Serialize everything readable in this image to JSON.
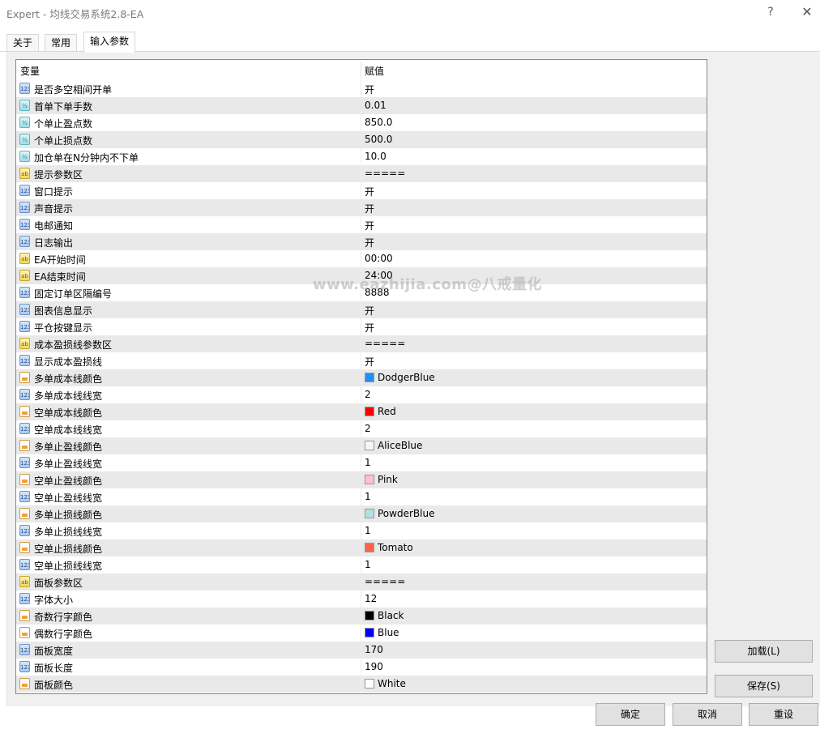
{
  "window": {
    "title": "Expert - 均线交易系统2.8-EA",
    "help": "?",
    "close": "✕"
  },
  "tabs": [
    {
      "label": "关于"
    },
    {
      "label": "常用"
    },
    {
      "label": "输入参数"
    }
  ],
  "grid": {
    "header_variable": "变量",
    "header_value": "赋值",
    "rows": [
      {
        "name": "是否多空相间开单",
        "value": "开",
        "type": "int"
      },
      {
        "name": "首单下单手数",
        "value": "0.01",
        "type": "dbl"
      },
      {
        "name": "个单止盈点数",
        "value": "850.0",
        "type": "dbl"
      },
      {
        "name": "个单止损点数",
        "value": "500.0",
        "type": "dbl"
      },
      {
        "name": "加仓单在N分钟内不下单",
        "value": "10.0",
        "type": "dbl"
      },
      {
        "name": "提示参数区",
        "value": "=====",
        "type": "str"
      },
      {
        "name": "窗口提示",
        "value": "开",
        "type": "int"
      },
      {
        "name": "声音提示",
        "value": "开",
        "type": "int"
      },
      {
        "name": "电邮通知",
        "value": "开",
        "type": "int"
      },
      {
        "name": "日志输出",
        "value": "开",
        "type": "int"
      },
      {
        "name": "EA开始时间",
        "value": "00:00",
        "type": "str"
      },
      {
        "name": "EA结束时间",
        "value": "24:00",
        "type": "str"
      },
      {
        "name": "固定订单区隔编号",
        "value": "8888",
        "type": "int"
      },
      {
        "name": "图表信息显示",
        "value": "开",
        "type": "int"
      },
      {
        "name": "平仓按键显示",
        "value": "开",
        "type": "int"
      },
      {
        "name": "成本盈损线参数区",
        "value": "=====",
        "type": "str"
      },
      {
        "name": "显示成本盈损线",
        "value": "开",
        "type": "int"
      },
      {
        "name": "多单成本线颜色",
        "value": "DodgerBlue",
        "type": "clr",
        "color": "#1E90FF"
      },
      {
        "name": "多单成本线线宽",
        "value": "2",
        "type": "int"
      },
      {
        "name": "空单成本线颜色",
        "value": "Red",
        "type": "clr",
        "color": "#FF0000"
      },
      {
        "name": "空单成本线线宽",
        "value": "2",
        "type": "int"
      },
      {
        "name": "多单止盈线颜色",
        "value": "AliceBlue",
        "type": "clr",
        "color": "#F0F8FF"
      },
      {
        "name": "多单止盈线线宽",
        "value": "1",
        "type": "int"
      },
      {
        "name": "空单止盈线颜色",
        "value": "Pink",
        "type": "clr",
        "color": "#FFC0CB"
      },
      {
        "name": "空单止盈线线宽",
        "value": "1",
        "type": "int"
      },
      {
        "name": "多单止损线颜色",
        "value": "PowderBlue",
        "type": "clr",
        "color": "#B0E0E6"
      },
      {
        "name": "多单止损线线宽",
        "value": "1",
        "type": "int"
      },
      {
        "name": "空单止损线颜色",
        "value": "Tomato",
        "type": "clr",
        "color": "#FF6347"
      },
      {
        "name": "空单止损线线宽",
        "value": "1",
        "type": "int"
      },
      {
        "name": "面板参数区",
        "value": "=====",
        "type": "str"
      },
      {
        "name": "字体大小",
        "value": "12",
        "type": "int"
      },
      {
        "name": "奇数行字颜色",
        "value": "Black",
        "type": "clr",
        "color": "#000000"
      },
      {
        "name": "偶数行字颜色",
        "value": "Blue",
        "type": "clr",
        "color": "#0000FF"
      },
      {
        "name": "面板宽度",
        "value": "170",
        "type": "int"
      },
      {
        "name": "面板长度",
        "value": "190",
        "type": "int"
      },
      {
        "name": "面板颜色",
        "value": "White",
        "type": "clr",
        "color": "#FFFFFF"
      }
    ]
  },
  "watermark": "www.eazhijia.com@八戒量化",
  "buttons": {
    "load": "加载(L)",
    "save": "保存(S)",
    "ok": "确定",
    "cancel": "取消",
    "reset": "重设"
  }
}
